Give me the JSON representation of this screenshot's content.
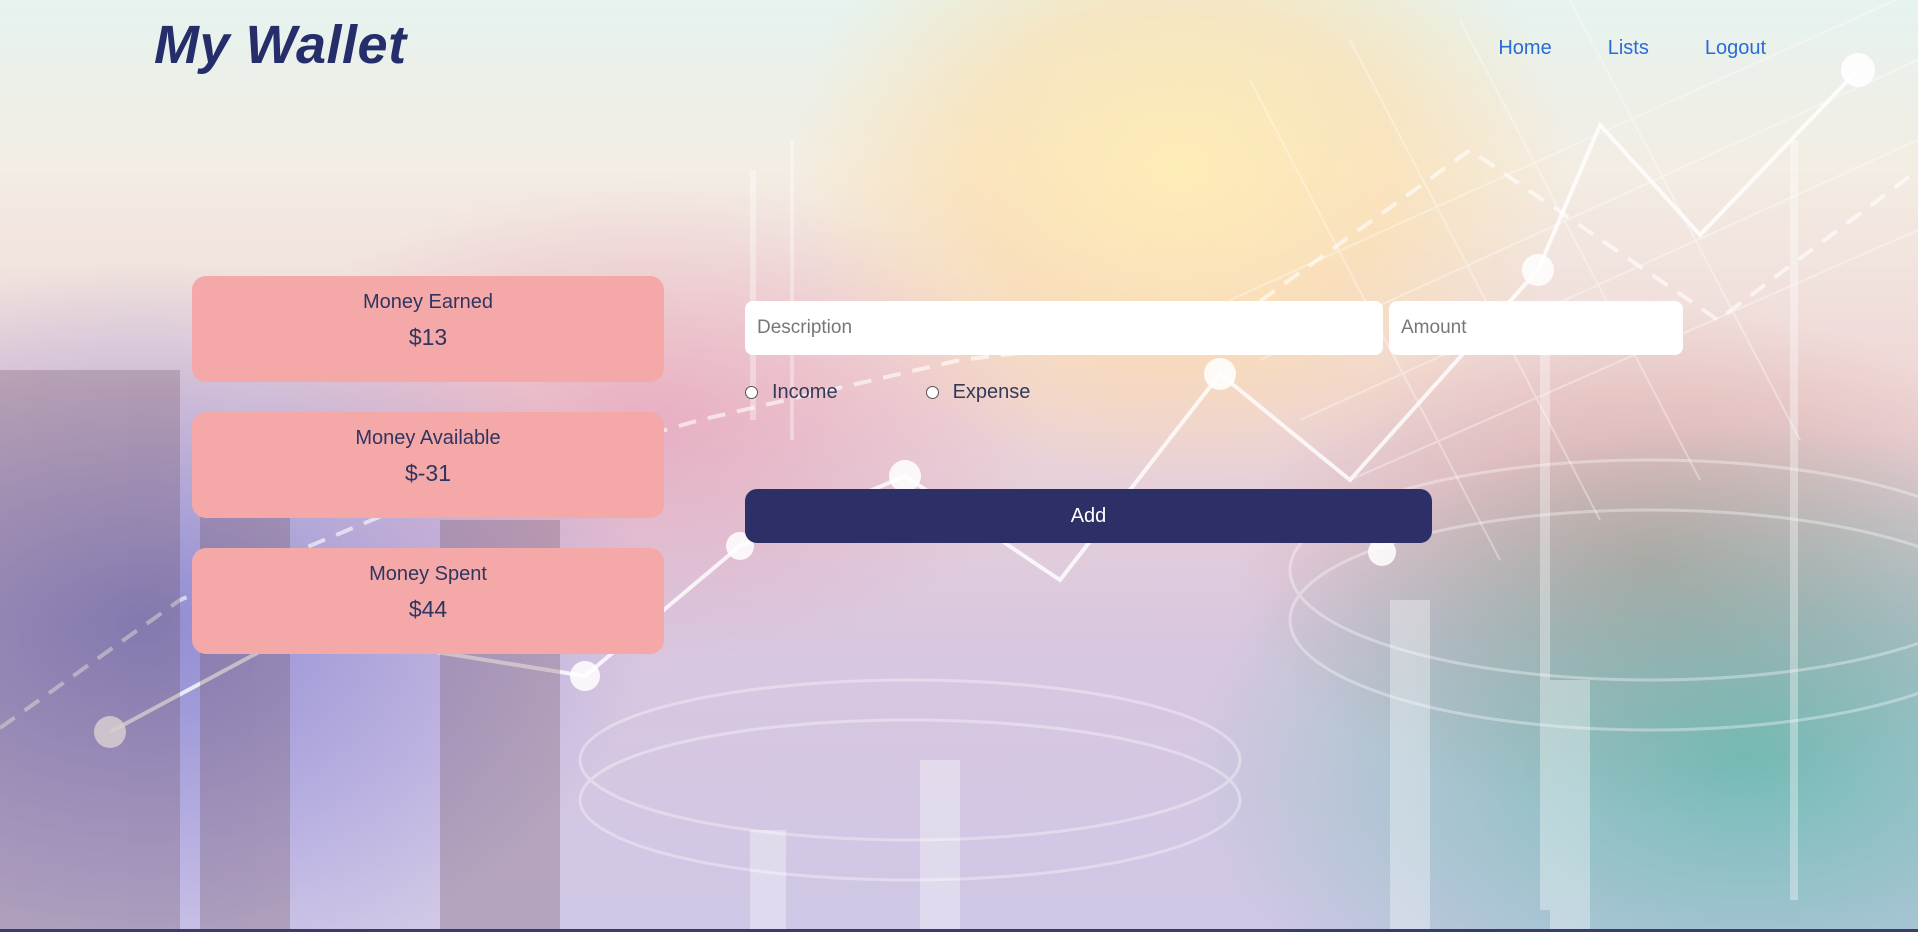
{
  "header": {
    "logo": "My Wallet",
    "nav": [
      {
        "label": "Home"
      },
      {
        "label": "Lists"
      },
      {
        "label": "Logout"
      }
    ]
  },
  "stats": [
    {
      "title": "Money Earned",
      "value": "$13"
    },
    {
      "title": "Money Available",
      "value": "$-31"
    },
    {
      "title": "Money Spent",
      "value": "$44"
    }
  ],
  "form": {
    "description_placeholder": "Description",
    "amount_placeholder": "Amount",
    "radio_income": "Income",
    "radio_expense": "Expense",
    "add_label": "Add"
  },
  "colors": {
    "card_bg": "#f4a9a8",
    "brand_navy": "#2c3066",
    "nav_link": "#2a6bd6"
  }
}
